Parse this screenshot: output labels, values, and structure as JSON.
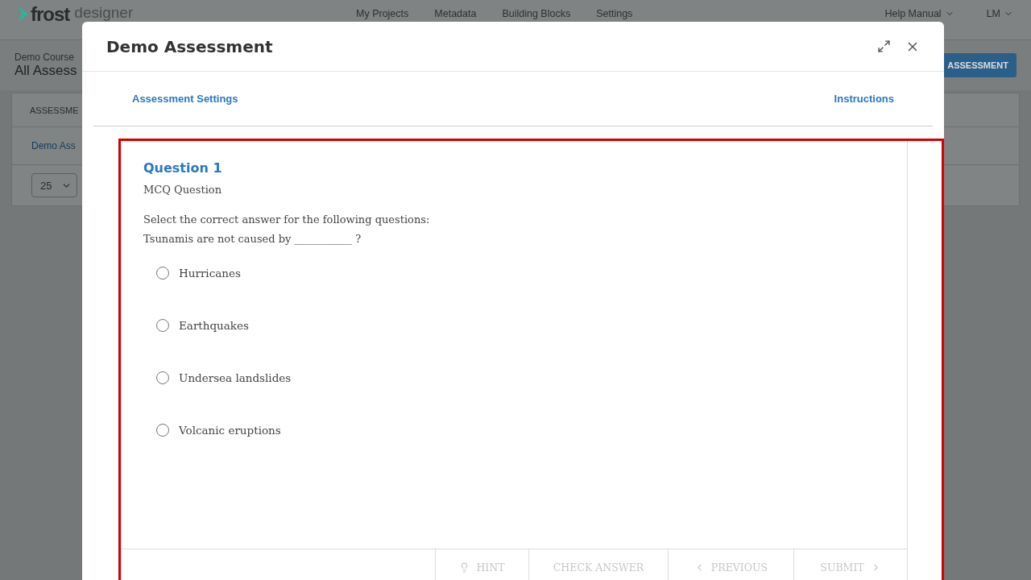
{
  "background": {
    "logo": {
      "brand": "frost",
      "suffix": "designer"
    },
    "nav": [
      "My Projects",
      "Metadata",
      "Building Blocks",
      "Settings"
    ],
    "help_menu": "Help Manual",
    "user_menu": "LM",
    "breadcrumb": "Demo Course",
    "page_title": "All Assess",
    "add_button": "ASSESSMENT",
    "table": {
      "column_1": "ASSESSME",
      "rows": [
        "Demo Ass"
      ],
      "page_size": "25"
    }
  },
  "modal": {
    "title": "Demo Assessment",
    "tabs": [
      {
        "label": "Assessment Settings"
      },
      {
        "label": "Instructions"
      }
    ],
    "question": {
      "title": "Question 1",
      "type": "MCQ Question",
      "prompt": [
        "Select the correct answer for the following questions:",
        "Tsunamis are not caused by ___________ ?"
      ],
      "options": [
        {
          "label": "Hurricanes",
          "selected": false
        },
        {
          "label": "Earthquakes",
          "selected": false
        },
        {
          "label": "Undersea landslides",
          "selected": false
        },
        {
          "label": "Volcanic eruptions",
          "selected": false
        }
      ]
    },
    "footer_buttons": [
      {
        "kind": "hint",
        "label": "HINT",
        "disabled": true
      },
      {
        "kind": "plain",
        "label": "CHECK ANSWER",
        "disabled": true
      },
      {
        "kind": "previous",
        "label": "PREVIOUS",
        "disabled": true
      },
      {
        "kind": "next",
        "label": "SUBMIT",
        "disabled": true
      }
    ]
  }
}
